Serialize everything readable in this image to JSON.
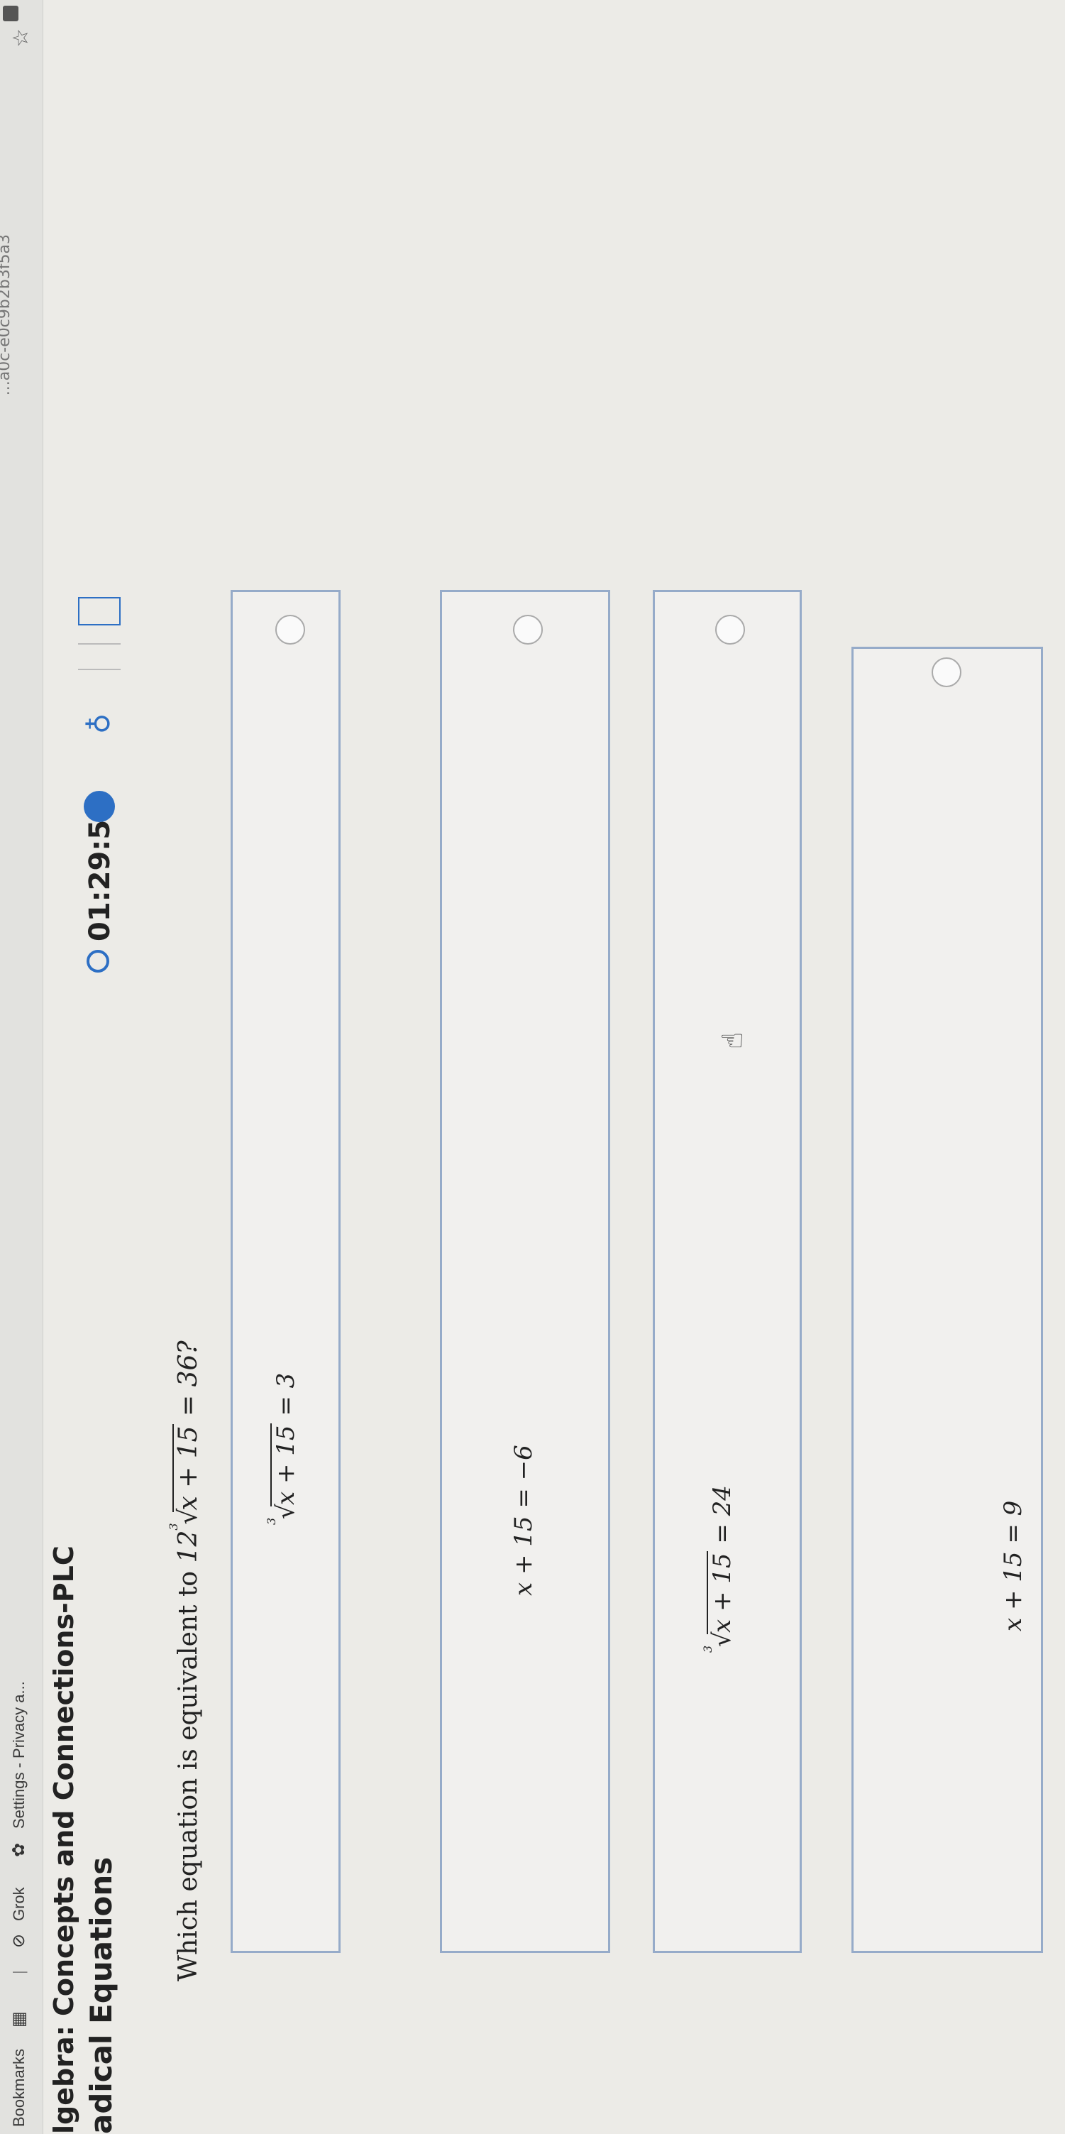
{
  "browser": {
    "bookmarks_label": "Bookmarks",
    "grok_label": "Grok",
    "settings_label": "Settings - Privacy a...",
    "url_fragment": "...a0c-e0c9b2b3f5a3"
  },
  "header": {
    "course_title": "lgebra: Concepts and Connections-PLC",
    "lesson_title": "adical Equations",
    "timer": "01:29:58"
  },
  "question": {
    "prefix": "Which equation is equivalent to",
    "coef": "12",
    "radicand": "x + 15",
    "suffix": "= 36?",
    "root_index": "3"
  },
  "options": [
    {
      "type": "radical",
      "index": "3",
      "radicand": "x + 15",
      "rhs": "= 3"
    },
    {
      "type": "plain",
      "lhs": "x + 15",
      "rhs": "= −6"
    },
    {
      "type": "radical",
      "index": "3",
      "radicand": "x + 15",
      "rhs": "= 24"
    },
    {
      "type": "plain",
      "lhs": "x + 15",
      "rhs": "= 9"
    }
  ]
}
